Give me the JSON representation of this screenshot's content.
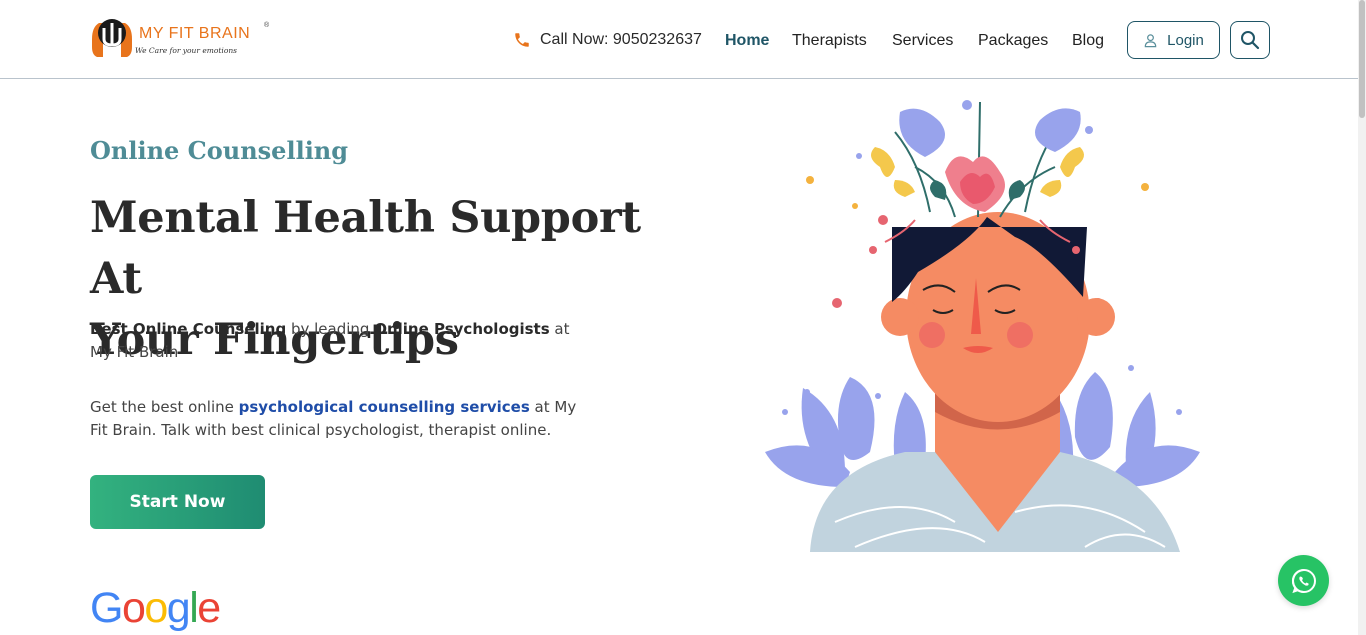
{
  "header": {
    "logo": {
      "name": "MY FIT BRAIN",
      "registered": "®",
      "tagline": "We Care for your emotions"
    },
    "call": {
      "label": "Call Now: 9050232637",
      "icon": "phone-icon"
    },
    "nav": [
      {
        "label": "Home",
        "active": true
      },
      {
        "label": "Therapists",
        "active": false
      },
      {
        "label": "Services",
        "active": false
      },
      {
        "label": "Packages",
        "active": false
      },
      {
        "label": "Blog",
        "active": false
      }
    ],
    "login": {
      "label": "Login",
      "icon": "user-icon"
    },
    "search": {
      "icon": "search-icon"
    }
  },
  "hero": {
    "eyebrow": "Online Counselling",
    "headline_line1": "Mental Health Support At",
    "headline_line2": "Your Fingertips",
    "para1": {
      "bold1": "Best Online Counseling",
      "text1": " by leading ",
      "bold2": "Online Psychologists",
      "text2": " at My Fit Brain"
    },
    "para2": {
      "text1": "Get the best online ",
      "link": "psychological counselling services",
      "text2": " at My Fit Brain. Talk with best clinical psychologist, therapist online."
    },
    "cta": "Start Now",
    "google_logo": "Google"
  },
  "widgets": {
    "whatsapp_icon": "whatsapp-icon"
  },
  "colors": {
    "accent_teal": "#1f5566",
    "eyebrow": "#4f8c96",
    "logo_orange": "#e8741c",
    "cta_start": "#33b27f",
    "cta_end": "#1f8c72",
    "link_blue": "#1f4da8",
    "whatsapp": "#27c365"
  }
}
